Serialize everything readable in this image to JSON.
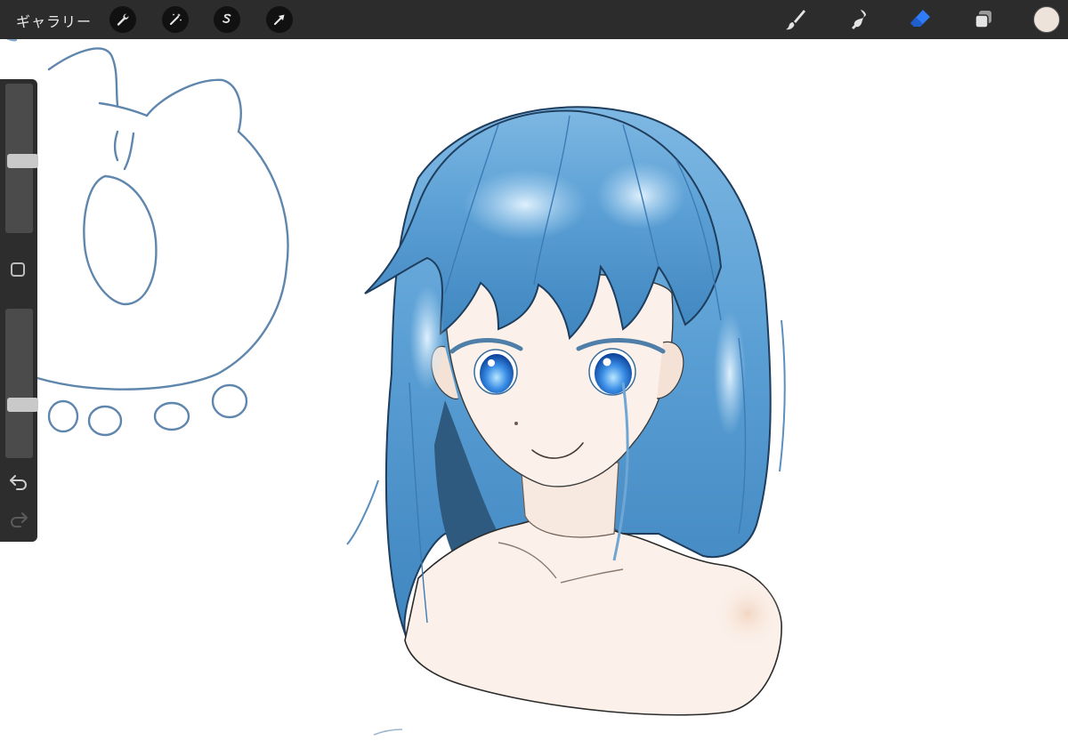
{
  "topbar": {
    "gallery_label": "ギャラリー",
    "left_tools": [
      "wrench-icon",
      "magic-wand-icon",
      "selection-s-icon",
      "arrow-cursor-icon"
    ],
    "right_tools": [
      "brush-icon",
      "smudge-icon",
      "eraser-icon",
      "layers-icon"
    ],
    "active_tool": "eraser",
    "active_color": "#ede3da"
  },
  "colors": {
    "toolbar_bg": "#2c2c2c",
    "eraser_active": "#2f7cf6",
    "hair_light": "#8ec4ea",
    "hair_mid": "#5a9fd4",
    "hair_dark": "#2c6a9e",
    "shadow_navy": "#2f5a80",
    "skin": "#fbf1ea",
    "sketch_line": "#5f86ad"
  },
  "sidebar": {
    "brush_size_level": 0.48,
    "brush_opacity_level": 0.34
  }
}
